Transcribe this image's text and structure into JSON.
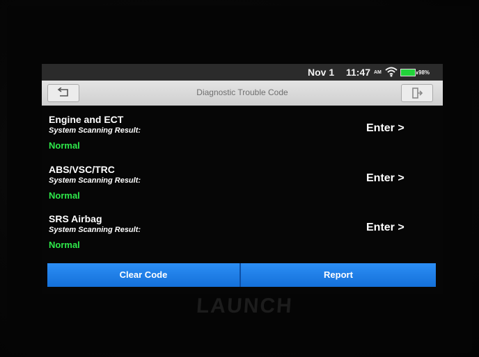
{
  "status_bar": {
    "date": "Nov 1",
    "time": "11:47",
    "am_pm": "AM",
    "battery": "98%"
  },
  "title_bar": {
    "title": "Diagnostic Trouble Code"
  },
  "systems": [
    {
      "name": "Engine and ECT",
      "scan_label": "System Scanning Result:",
      "status": "Normal",
      "enter_label": "Enter >"
    },
    {
      "name": "ABS/VSC/TRC",
      "scan_label": "System Scanning Result:",
      "status": "Normal",
      "enter_label": "Enter >"
    },
    {
      "name": "SRS Airbag",
      "scan_label": "System Scanning Result:",
      "status": "Normal",
      "enter_label": "Enter >"
    }
  ],
  "actions": {
    "clear_code": "Clear Code",
    "report": "Report"
  },
  "device": {
    "brand": "LAUNCH"
  },
  "colors": {
    "status_ok": "#2ee94a",
    "action_bar": "#1e80ea",
    "title_bar": "#d8d8d8"
  }
}
